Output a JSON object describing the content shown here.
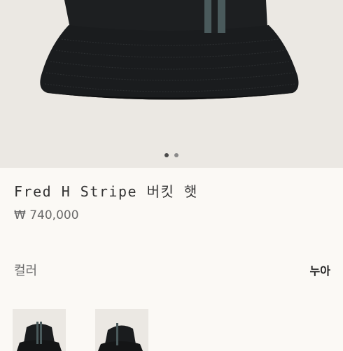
{
  "product": {
    "title": "Fred H Stripe 버킷 햇",
    "price": "₩ 740,000"
  },
  "gallery": {
    "dot_count": 2,
    "active_index": 0
  },
  "color_option": {
    "label": "컬러",
    "selected": "누아"
  },
  "colors": {
    "background": "#fbf9f5",
    "image_background": "#ebe8e3",
    "hat": "#1b1d1f",
    "stripe": "#4a5a5c"
  }
}
